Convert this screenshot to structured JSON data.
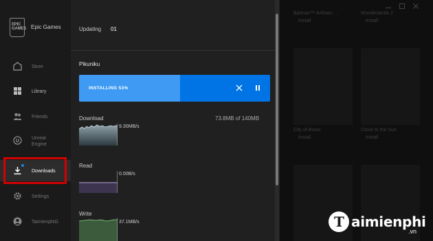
{
  "sidebar": {
    "brand": "Epic Games",
    "logo_text": "EPIC\nGAMES",
    "items": [
      {
        "label": "Store",
        "icon": "store-icon"
      },
      {
        "label": "Library",
        "icon": "library-icon"
      },
      {
        "label": "Friends",
        "icon": "friends-icon"
      },
      {
        "label": "Unreal\nEngine",
        "icon": "unreal-engine-icon"
      },
      {
        "label": "Downloads",
        "icon": "download-icon"
      },
      {
        "label": "Settings",
        "icon": "gear-icon"
      },
      {
        "label": "TaimienphiG",
        "icon": "user-icon"
      }
    ],
    "downloads_badge_color": "#1e88e5",
    "highlight_color": "#d50000"
  },
  "downloads": {
    "updating_label": "Updating",
    "updating_count": "01",
    "game_title": "Pikuniku",
    "progress_label": "INSTALLING 53%",
    "progress_value": 0.53,
    "accent": "#0074e4",
    "size_text": "73.8MB of 140MB",
    "download": {
      "label": "Download",
      "rate": "9.30MB/s"
    },
    "read": {
      "label": "Read",
      "rate": "0.00B/s"
    },
    "write": {
      "label": "Write",
      "rate": "37.1MB/s"
    }
  },
  "library_background": {
    "tiles": [
      {
        "title": "Batman™ Arkham ...",
        "sub": "Install"
      },
      {
        "title": "Wonderlands 2",
        "sub": "Install"
      },
      {
        "title": "City of Brass",
        "sub": "Install"
      },
      {
        "title": "Close to the Sun",
        "sub": "Install"
      }
    ]
  },
  "watermark": {
    "text": "aimienphi",
    "suffix": ".vn",
    "mark": "T"
  }
}
